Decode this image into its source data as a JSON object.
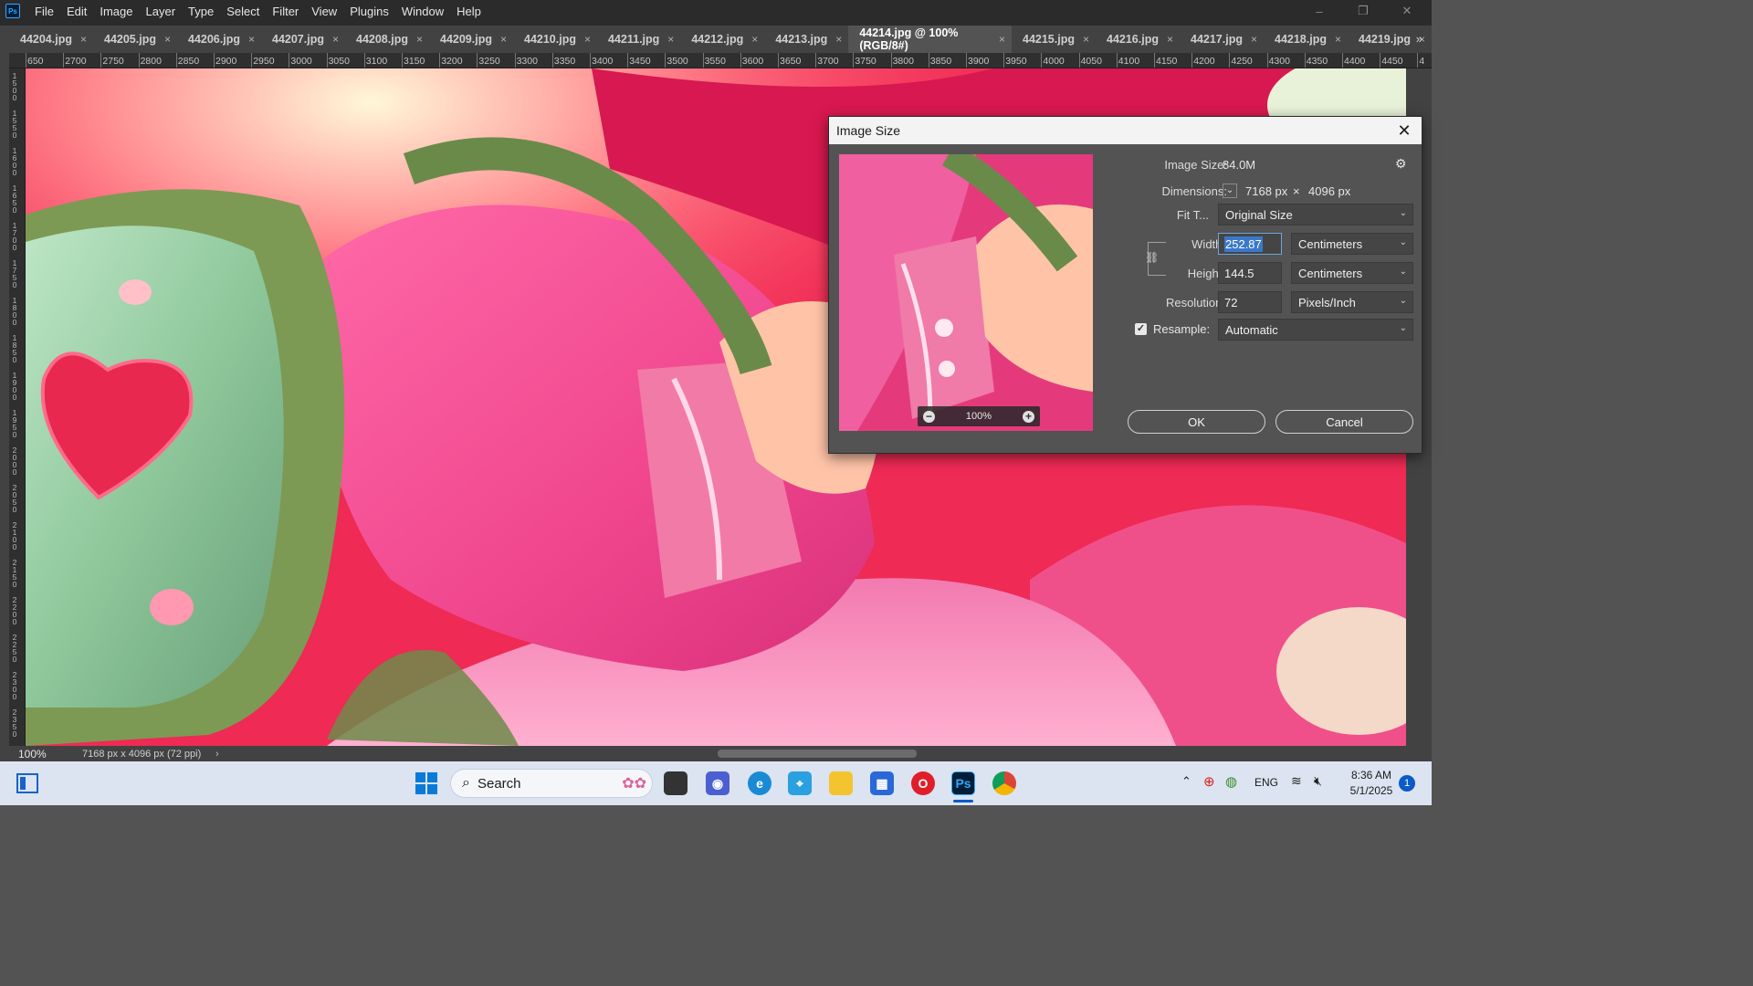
{
  "app": {
    "logo": "Ps"
  },
  "menu": [
    "File",
    "Edit",
    "Image",
    "Layer",
    "Type",
    "Select",
    "Filter",
    "View",
    "Plugins",
    "Window",
    "Help"
  ],
  "window_controls": {
    "minimize": "–",
    "maximize": "❐",
    "close": "✕"
  },
  "tabs": [
    {
      "label": "44204.jpg",
      "active": false
    },
    {
      "label": "44205.jpg",
      "active": false
    },
    {
      "label": "44206.jpg",
      "active": false
    },
    {
      "label": "44207.jpg",
      "active": false
    },
    {
      "label": "44208.jpg",
      "active": false
    },
    {
      "label": "44209.jpg",
      "active": false
    },
    {
      "label": "44210.jpg",
      "active": false
    },
    {
      "label": "44211.jpg",
      "active": false
    },
    {
      "label": "44212.jpg",
      "active": false
    },
    {
      "label": "44213.jpg",
      "active": false
    },
    {
      "label": "44214.jpg @ 100% (RGB/8#)",
      "active": true
    },
    {
      "label": "44215.jpg",
      "active": false
    },
    {
      "label": "44216.jpg",
      "active": false
    },
    {
      "label": "44217.jpg",
      "active": false
    },
    {
      "label": "44218.jpg",
      "active": false
    },
    {
      "label": "44219.jpg",
      "active": false
    }
  ],
  "tab_close_glyph": "×",
  "tab_overflow": "»",
  "ruler_top": [
    "650",
    "2700",
    "2750",
    "2800",
    "2850",
    "2900",
    "2950",
    "3000",
    "3050",
    "3100",
    "3150",
    "3200",
    "3250",
    "3300",
    "3350",
    "3400",
    "3450",
    "3500",
    "3550",
    "3600",
    "3650",
    "3700",
    "3750",
    "3800",
    "3850",
    "3900",
    "3950",
    "4000",
    "4050",
    "4100",
    "4150",
    "4200",
    "4250",
    "4300",
    "4350",
    "4400",
    "4450",
    "4"
  ],
  "ruler_left": [
    "1500",
    "1550",
    "1600",
    "1650",
    "1700",
    "1750",
    "1800",
    "1850",
    "1900",
    "1950",
    "2000",
    "2050",
    "2100",
    "2150",
    "2200",
    "2250",
    "2300",
    "2350"
  ],
  "status": {
    "zoom": "100%",
    "doc_info": "7168 px x 4096 px (72 ppi)",
    "arrow": "›"
  },
  "dialog": {
    "title": "Image Size",
    "close": "✕",
    "image_size_label": "Image Size:",
    "image_size_value": "84.0M",
    "settings_icon": "⚙",
    "dimensions_label": "Dimensions:",
    "dimensions_width": "7168 px",
    "dimensions_x": "×",
    "dimensions_height": "4096 px",
    "fit_to_label": "Fit T...",
    "fit_to_value": "Original Size",
    "width_label": "Width:",
    "width_value": "252.87",
    "width_unit": "Centimeters",
    "height_label": "Height:",
    "height_value": "144.5",
    "height_unit": "Centimeters",
    "resolution_label": "Resolution:",
    "resolution_value": "72",
    "resolution_unit": "Pixels/Inch",
    "resample_label": "Resample:",
    "resample_checked": true,
    "resample_value": "Automatic",
    "preview_zoom": "100%",
    "ok_label": "OK",
    "cancel_label": "Cancel"
  },
  "taskbar": {
    "search_placeholder": "Search",
    "language": "ENG",
    "time": "8:36 AM",
    "date": "5/1/2025",
    "notifications": "1",
    "pinned": [
      "file-explorer-icon",
      "edge-icon",
      "photoshop-icon",
      "opera-icon",
      "chrome-icon"
    ]
  },
  "colors": {
    "ps_bg": "#535353",
    "menubar": "#2b2b2b",
    "tabbar": "#424242",
    "accent_selection": "#3a78c8",
    "taskbar": "#dbe4f0"
  }
}
